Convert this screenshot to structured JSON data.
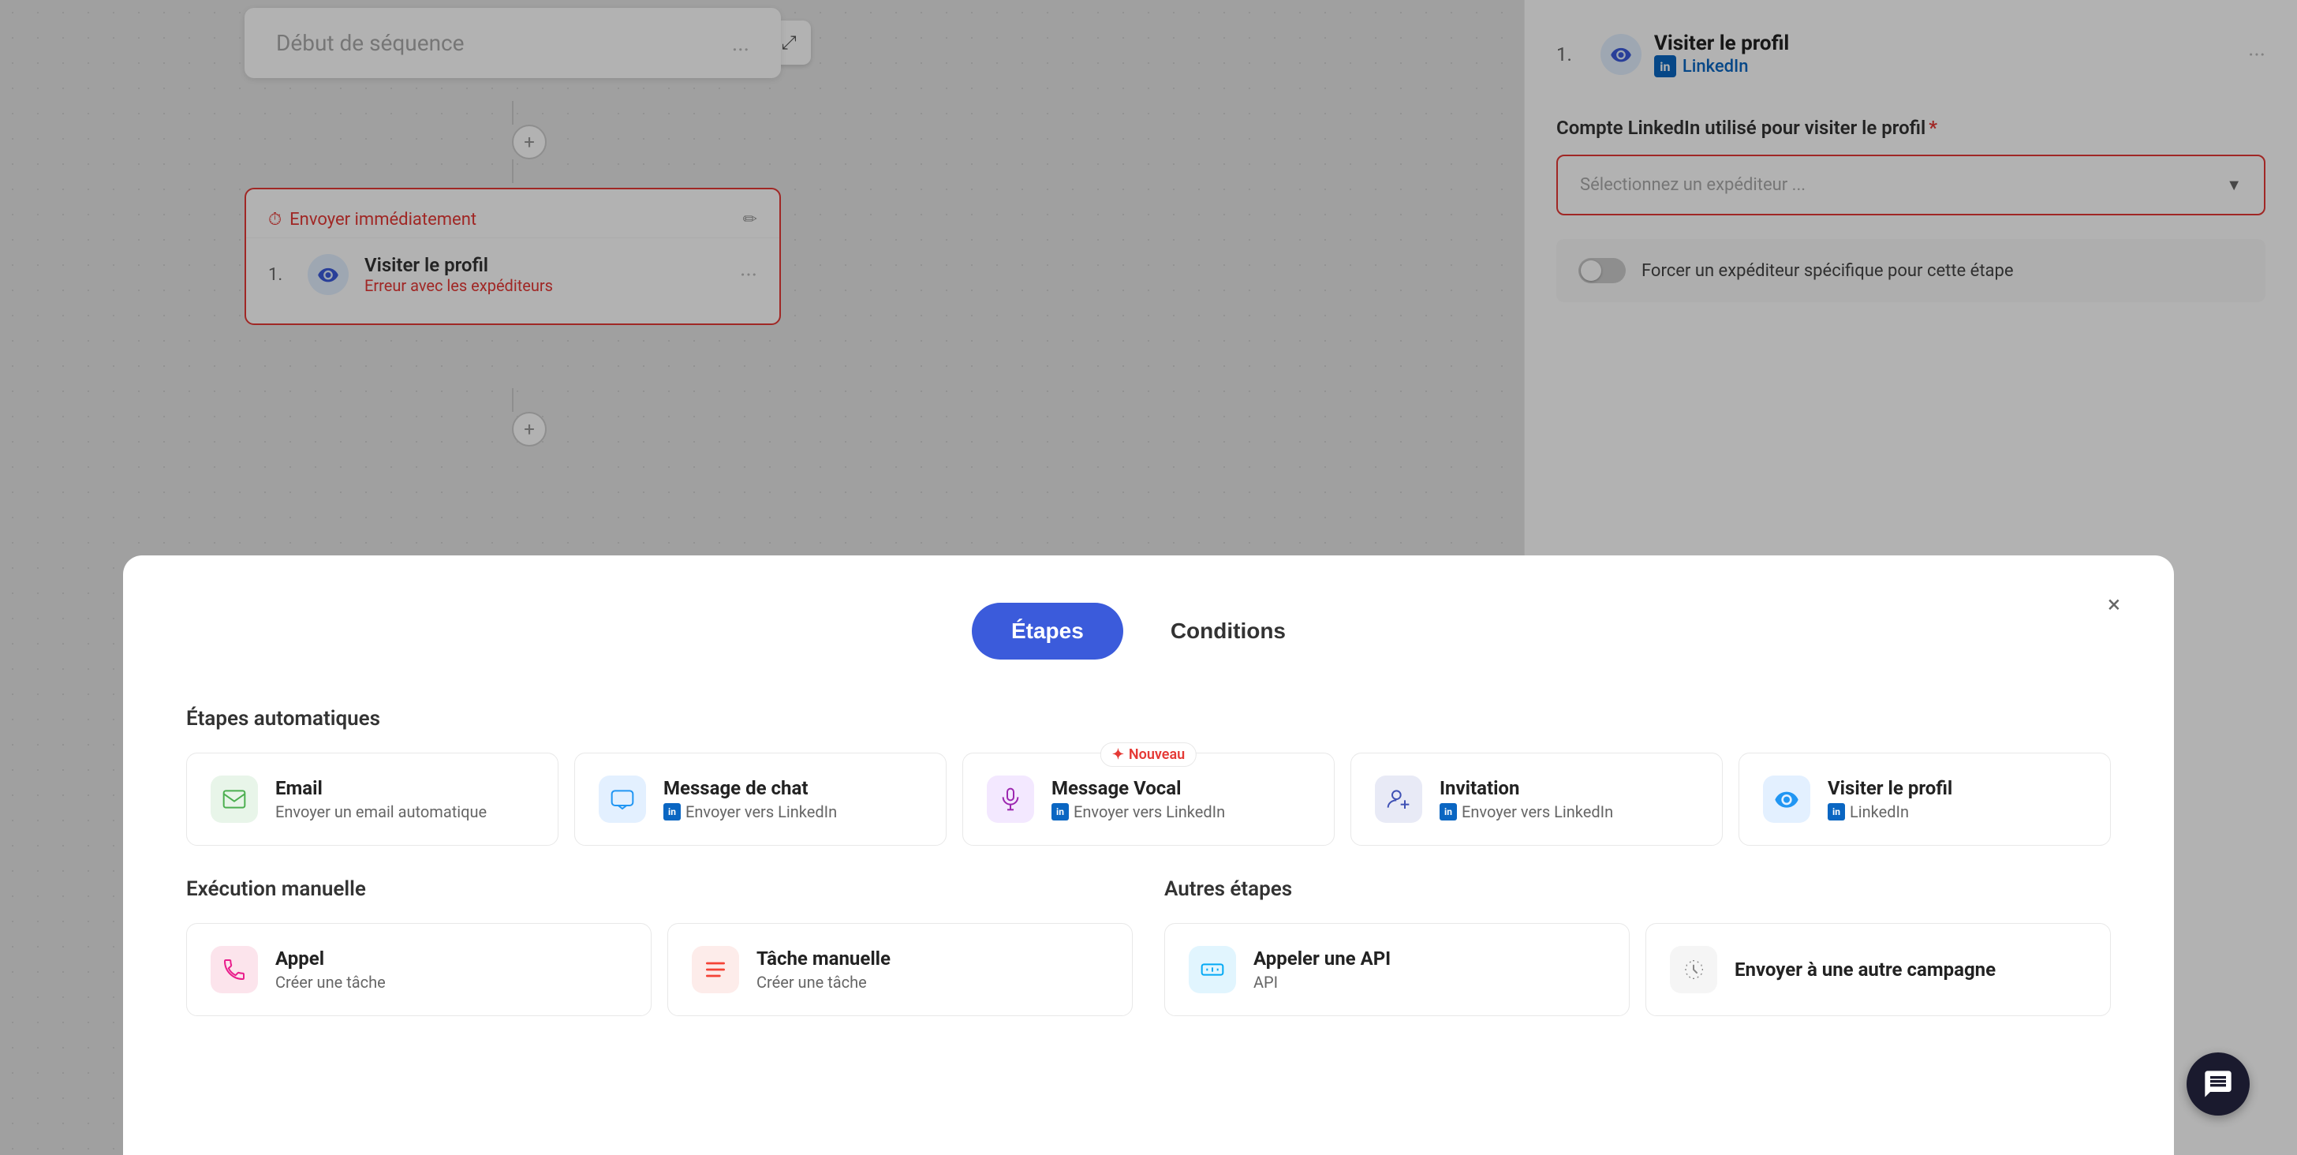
{
  "canvas": {
    "sequence_card": {
      "title": "Début de séquence",
      "dots": "..."
    },
    "step_block": {
      "timer_label": "Envoyer immédiatement",
      "step_number": "1.",
      "step_title": "Visiter le profil",
      "step_error": "Erreur avec les expéditeurs"
    }
  },
  "right_panel": {
    "step_num": "1.",
    "step_title": "Visiter le profil",
    "linkedin_label": "LinkedIn",
    "section_label": "Compte LinkedIn utilisé pour visiter le profil",
    "required": "*",
    "select_placeholder": "Sélectionnez un expéditeur ...",
    "toggle_label": "Forcer un expéditeur spécifique pour cette étape"
  },
  "modal": {
    "close": "×",
    "tabs": [
      {
        "id": "etapes",
        "label": "Étapes",
        "active": true
      },
      {
        "id": "conditions",
        "label": "Conditions",
        "active": false
      }
    ],
    "auto_section_title": "Étapes automatiques",
    "auto_cards": [
      {
        "id": "email",
        "title": "Email",
        "subtitle": "Envoyer un email automatique",
        "icon_type": "green",
        "linkedin": false,
        "nouveau": false
      },
      {
        "id": "message-chat",
        "title": "Message de chat",
        "subtitle": "Envoyer vers LinkedIn",
        "icon_type": "blue",
        "linkedin": true,
        "nouveau": false
      },
      {
        "id": "message-vocal",
        "title": "Message Vocal",
        "subtitle": "Envoyer vers LinkedIn",
        "icon_type": "purple",
        "linkedin": true,
        "nouveau": true
      },
      {
        "id": "invitation",
        "title": "Invitation",
        "subtitle": "Envoyer vers LinkedIn",
        "icon_type": "indigo",
        "linkedin": true,
        "nouveau": false
      },
      {
        "id": "visiter-profil",
        "title": "Visiter le profil",
        "subtitle": "LinkedIn",
        "icon_type": "blue",
        "linkedin": true,
        "nouveau": false
      }
    ],
    "manual_section_title": "Exécution manuelle",
    "manual_cards": [
      {
        "id": "appel",
        "title": "Appel",
        "subtitle": "Créer une tâche",
        "icon_type": "pink",
        "linkedin": false,
        "nouveau": false
      },
      {
        "id": "tache-manuelle",
        "title": "Tâche manuelle",
        "subtitle": "Créer une tâche",
        "icon_type": "salmon",
        "linkedin": false,
        "nouveau": false
      }
    ],
    "other_section_title": "Autres étapes",
    "other_cards": [
      {
        "id": "api",
        "title": "Appeler une API",
        "subtitle": "API",
        "icon_type": "light-blue",
        "linkedin": false,
        "nouveau": false
      },
      {
        "id": "autre-campagne",
        "title": "Envoyer à une autre campagne",
        "subtitle": "",
        "icon_type": "hand",
        "linkedin": false,
        "nouveau": false
      }
    ],
    "nouveau_label": "Nouveau"
  },
  "zoom": {
    "minus": "−",
    "plus": "+",
    "expand": "⤢"
  }
}
